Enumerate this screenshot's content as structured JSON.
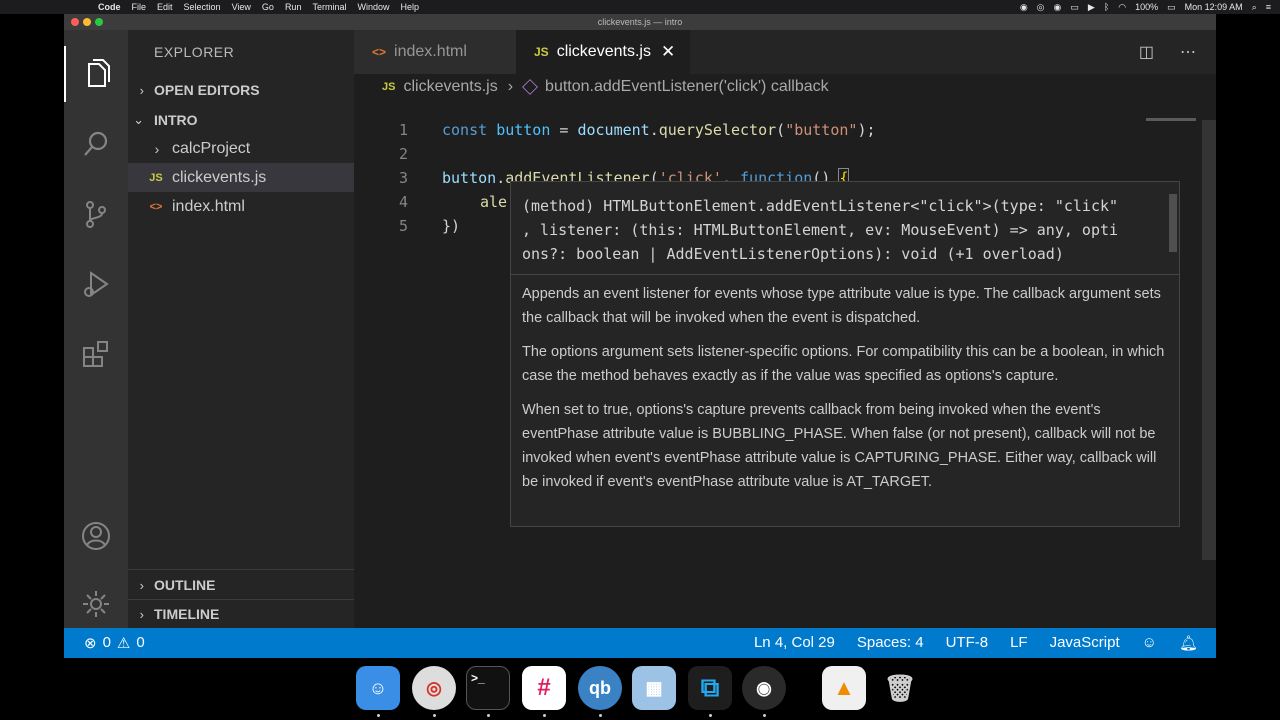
{
  "menubar": {
    "apple": "",
    "items": [
      "Code",
      "File",
      "Edit",
      "Selection",
      "View",
      "Go",
      "Run",
      "Terminal",
      "Window",
      "Help"
    ],
    "battery": "100%",
    "clock": "Mon 12:09 AM"
  },
  "window": {
    "title": "clickevents.js — intro"
  },
  "sidebar": {
    "title": "EXPLORER",
    "open_editors": "OPEN EDITORS",
    "folder": "INTRO",
    "items": [
      {
        "label": "calcProject",
        "icon": "chevron-right"
      },
      {
        "label": "clickevents.js",
        "icon": "JS"
      },
      {
        "label": "index.html",
        "icon": "<>"
      }
    ],
    "outline": "OUTLINE",
    "timeline": "TIMELINE"
  },
  "tabs": [
    {
      "label": "index.html",
      "icon": "<>"
    },
    {
      "label": "clickevents.js",
      "icon": "JS",
      "close": "✕"
    }
  ],
  "breadcrumbs": {
    "file": "clickevents.js",
    "symbol": "button.addEventListener('click') callback"
  },
  "code": {
    "line_numbers": [
      "1",
      "2",
      "3",
      "4",
      "5"
    ],
    "line4_partial": "ale",
    "line5": "})"
  },
  "hover": {
    "signature": [
      "(method) HTMLButtonElement.addEventListener<\"click\">(type: \"click\"",
      ", listener: (this: HTMLButtonElement, ev: MouseEvent) => any, opti",
      "ons?: boolean | AddEventListenerOptions): void (+1 overload)"
    ],
    "doc": [
      "Appends an event listener for events whose type attribute value is type. The callback argument sets the callback that will be invoked when the event is dispatched.",
      "The options argument sets listener-specific options. For compatibility this can be a boolean, in which case the method behaves exactly as if the value was specified as options's capture.",
      "When set to true, options's capture prevents callback from being invoked when the event's eventPhase attribute value is BUBBLING_PHASE. When false (or not present), callback will not be invoked when event's eventPhase attribute value is CAPTURING_PHASE. Either way, callback will be invoked if event's eventPhase attribute value is AT_TARGET."
    ]
  },
  "statusbar": {
    "errors": "0",
    "warnings": "0",
    "position": "Ln 4, Col 29",
    "spaces": "Spaces: 4",
    "encoding": "UTF-8",
    "eol": "LF",
    "language": "JavaScript"
  },
  "dock": {
    "items": [
      "Finder",
      "Chrome",
      "Terminal",
      "Slack",
      "qBittorrent",
      "Preview",
      "VS Code",
      "OBS",
      "VLC",
      "Trash"
    ]
  },
  "colors": {
    "accent": "#007acc",
    "sidebar": "#252526",
    "editor": "#1e1e1e",
    "activitybar": "#333333"
  }
}
